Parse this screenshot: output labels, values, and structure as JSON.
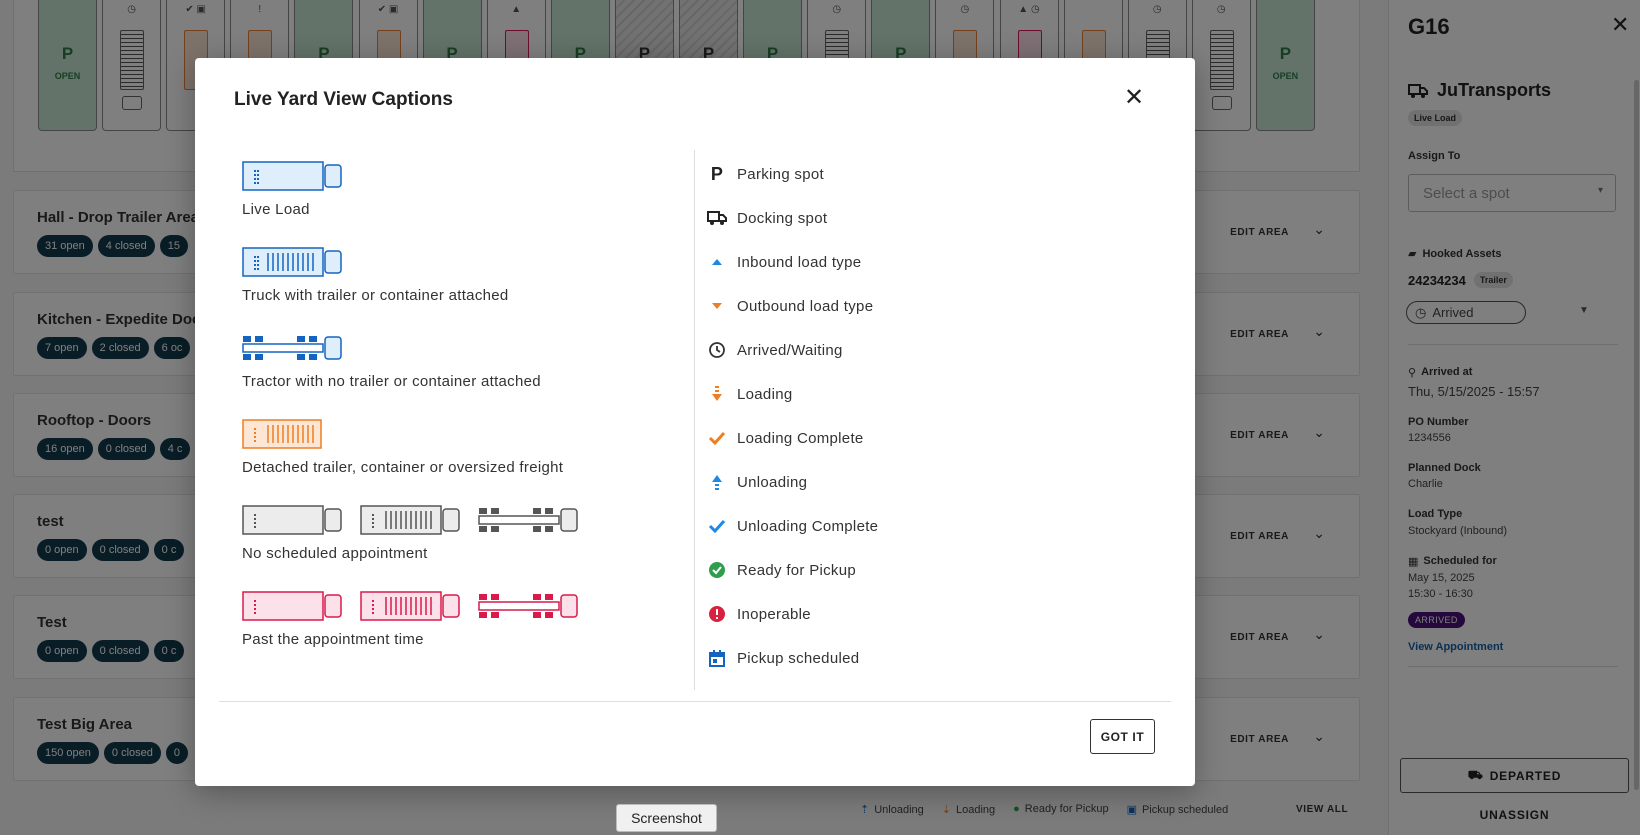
{
  "yard": {
    "spots": [
      {
        "kind": "open",
        "p": "P",
        "label": "OPEN"
      },
      {
        "kind": "trailer",
        "status": "◷"
      },
      {
        "kind": "org",
        "status": "✔ ▣"
      },
      {
        "kind": "org",
        "status": "!"
      },
      {
        "kind": "open",
        "p": "P"
      },
      {
        "kind": "org",
        "status": "✔ ▣"
      },
      {
        "kind": "open",
        "p": "P"
      },
      {
        "kind": "tractor",
        "status": "▲"
      },
      {
        "kind": "open",
        "p": "P"
      },
      {
        "kind": "hatch",
        "p": "P"
      },
      {
        "kind": "hatch",
        "p": "P"
      },
      {
        "kind": "open",
        "p": "P"
      },
      {
        "kind": "trailer",
        "status": "◷"
      },
      {
        "kind": "open",
        "p": "P"
      },
      {
        "kind": "org",
        "status": "◷"
      },
      {
        "kind": "pink",
        "status": "▲ ◷"
      },
      {
        "kind": "org"
      },
      {
        "kind": "trailer",
        "status": "◷"
      },
      {
        "kind": "trailer",
        "status": "◷"
      },
      {
        "kind": "open",
        "p": "P",
        "label": "OPEN"
      }
    ]
  },
  "areas": [
    {
      "title": "Hall - Drop Trailer Area",
      "chips": [
        "31 open",
        "4 closed",
        "15"
      ],
      "edit": "EDIT AREA"
    },
    {
      "title": "Kitchen - Expedite Doo",
      "chips": [
        "7 open",
        "2 closed",
        "6 oc"
      ],
      "edit": "EDIT AREA"
    },
    {
      "title": "Rooftop - Doors",
      "chips": [
        "16 open",
        "0 closed",
        "4 c"
      ],
      "edit": "EDIT AREA"
    },
    {
      "title": "test",
      "chips": [
        "0 open",
        "0 closed",
        "0 c"
      ],
      "edit": "EDIT AREA"
    },
    {
      "title": "Test",
      "chips": [
        "0 open",
        "0 closed",
        "0 c"
      ],
      "edit": "EDIT AREA"
    },
    {
      "title": "Test Big Area",
      "chips": [
        "150 open",
        "0 closed",
        "0"
      ],
      "edit": "EDIT AREA"
    }
  ],
  "legend_bar": {
    "items": [
      "Unloading",
      "Loading",
      "Ready for Pickup",
      "Pickup scheduled"
    ],
    "view_all": "VIEW ALL"
  },
  "panel": {
    "title": "G16",
    "carrier": "JuTransports",
    "carrier_tag": "Live Load",
    "assign_to_label": "Assign To",
    "assign_placeholder": "Select a spot",
    "hooked_assets_label": "Hooked Assets",
    "asset_id": "24234234",
    "asset_tag": "Trailer",
    "asset_status": "Arrived",
    "arrived_at_label": "Arrived at",
    "arrived_at_value": "Thu, 5/15/2025 - 15:57",
    "po_label": "PO Number",
    "po_value": "1234556",
    "planned_dock_label": "Planned Dock",
    "planned_dock_value": "Charlie",
    "load_type_label": "Load Type",
    "load_type_value": "Stockyard (Inbound)",
    "scheduled_label": "Scheduled for",
    "scheduled_date": "May 15, 2025",
    "scheduled_time": "15:30 - 16:30",
    "appt_badge": "ARRIVED",
    "view_appointment": "View Appointment",
    "departed": "DEPARTED",
    "unassign": "UNASSIGN"
  },
  "modal": {
    "title": "Live Yard View Captions",
    "left_captions": [
      "Live Load",
      "Truck with trailer or container attached",
      "Tractor with no trailer or container attached",
      "Detached trailer, container or oversized freight",
      "No scheduled appointment",
      "Past the appointment time"
    ],
    "right_captions": [
      "Parking spot",
      "Docking spot",
      "Inbound load type",
      "Outbound load type",
      "Arrived/Waiting",
      "Loading",
      "Loading Complete",
      "Unloading",
      "Unloading Complete",
      "Ready for Pickup",
      "Inoperable",
      "Pickup scheduled"
    ],
    "got_it": "GOT IT"
  },
  "colors": {
    "blue": "#1565c0",
    "orange": "#ef7d22",
    "green": "#2e9e4a",
    "red": "#d6213f",
    "gray": "#555555",
    "pink": "#d81b4a"
  },
  "tooltip": "Screenshot"
}
